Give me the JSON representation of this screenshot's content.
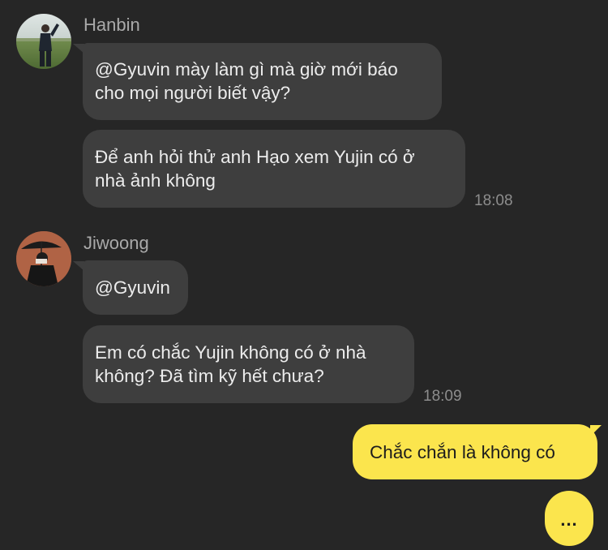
{
  "messages_group_1": {
    "sender": "Hanbin",
    "bubble_1": "@Gyuvin mày làm gì mà giờ mới báo\ncho mọi người biết vậy?",
    "bubble_2": "Để anh hỏi thử anh Hạo xem Yujin có ở\nnhà ảnh không",
    "time": "18:08",
    "avatar_icon": "profile-photo-person-field"
  },
  "messages_group_2": {
    "sender": "Jiwoong",
    "bubble_1": "@Gyuvin",
    "bubble_2": "Em có chắc Yujin không có ở nhà\nkhông? Đã tìm kỹ hết chưa?",
    "time": "18:09",
    "avatar_icon": "profile-photo-person-umbrella"
  },
  "my_message": {
    "text": "Chắc chắn là không có"
  },
  "typing_indicator": "...",
  "colors": {
    "background": "#262626",
    "other_bubble": "#3e3e3e",
    "my_bubble": "#fbe54d",
    "sender_name": "#a9a9a9",
    "timestamp": "#8d8d8d"
  }
}
